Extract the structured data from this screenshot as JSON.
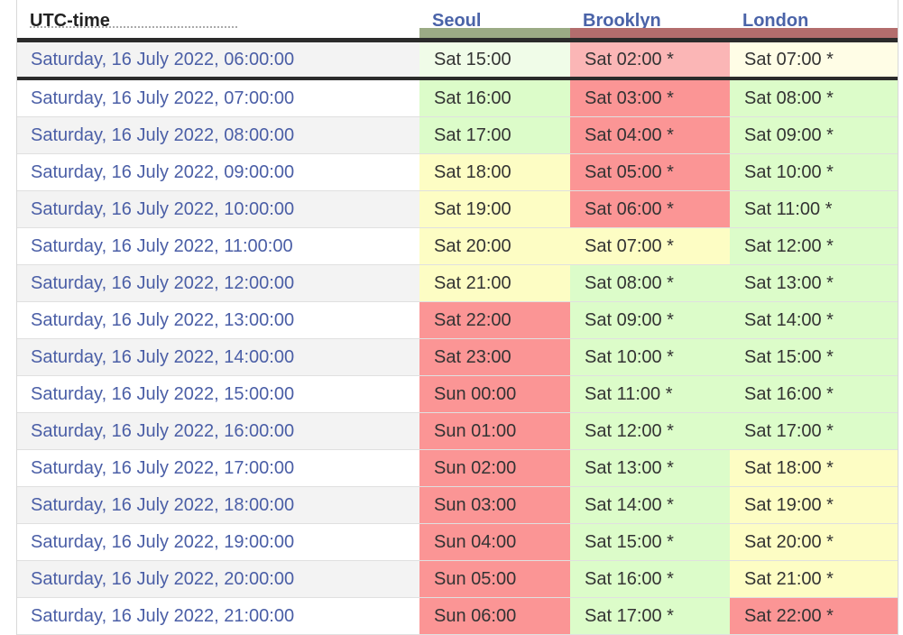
{
  "colors": {
    "green": "#dcfcc9",
    "yellow": "#fdfdc4",
    "red": "#fb9595",
    "pale_green": "#f0fce8",
    "pale_red": "#fbb6b6",
    "pale_yellow": "#fffde6",
    "header_green": "#9bab85",
    "header_red": "#b36d6d"
  },
  "header": {
    "utc_label": "UTC-time",
    "cities": [
      {
        "name": "Seoul",
        "strip": "header_green"
      },
      {
        "name": "Brooklyn",
        "strip": "header_red"
      },
      {
        "name": "London",
        "strip": "header_red"
      }
    ]
  },
  "rows": [
    {
      "utc": "Saturday, 16 July 2022, 06:00:00",
      "current": true,
      "cells": [
        {
          "t": "Sat 15:00",
          "c": "pale_green"
        },
        {
          "t": "Sat 02:00 *",
          "c": "pale_red"
        },
        {
          "t": "Sat 07:00 *",
          "c": "pale_yellow"
        }
      ]
    },
    {
      "utc": "Saturday, 16 July 2022, 07:00:00",
      "cells": [
        {
          "t": "Sat 16:00",
          "c": "green"
        },
        {
          "t": "Sat 03:00 *",
          "c": "red"
        },
        {
          "t": "Sat 08:00 *",
          "c": "green"
        }
      ]
    },
    {
      "utc": "Saturday, 16 July 2022, 08:00:00",
      "cells": [
        {
          "t": "Sat 17:00",
          "c": "green"
        },
        {
          "t": "Sat 04:00 *",
          "c": "red"
        },
        {
          "t": "Sat 09:00 *",
          "c": "green"
        }
      ]
    },
    {
      "utc": "Saturday, 16 July 2022, 09:00:00",
      "cells": [
        {
          "t": "Sat 18:00",
          "c": "yellow"
        },
        {
          "t": "Sat 05:00 *",
          "c": "red"
        },
        {
          "t": "Sat 10:00 *",
          "c": "green"
        }
      ]
    },
    {
      "utc": "Saturday, 16 July 2022, 10:00:00",
      "cells": [
        {
          "t": "Sat 19:00",
          "c": "yellow"
        },
        {
          "t": "Sat 06:00 *",
          "c": "red"
        },
        {
          "t": "Sat 11:00 *",
          "c": "green"
        }
      ]
    },
    {
      "utc": "Saturday, 16 July 2022, 11:00:00",
      "cells": [
        {
          "t": "Sat 20:00",
          "c": "yellow"
        },
        {
          "t": "Sat 07:00 *",
          "c": "yellow"
        },
        {
          "t": "Sat 12:00 *",
          "c": "green"
        }
      ]
    },
    {
      "utc": "Saturday, 16 July 2022, 12:00:00",
      "cells": [
        {
          "t": "Sat 21:00",
          "c": "yellow"
        },
        {
          "t": "Sat 08:00 *",
          "c": "green"
        },
        {
          "t": "Sat 13:00 *",
          "c": "green"
        }
      ]
    },
    {
      "utc": "Saturday, 16 July 2022, 13:00:00",
      "cells": [
        {
          "t": "Sat 22:00",
          "c": "red"
        },
        {
          "t": "Sat 09:00 *",
          "c": "green"
        },
        {
          "t": "Sat 14:00 *",
          "c": "green"
        }
      ]
    },
    {
      "utc": "Saturday, 16 July 2022, 14:00:00",
      "cells": [
        {
          "t": "Sat 23:00",
          "c": "red"
        },
        {
          "t": "Sat 10:00 *",
          "c": "green"
        },
        {
          "t": "Sat 15:00 *",
          "c": "green"
        }
      ]
    },
    {
      "utc": "Saturday, 16 July 2022, 15:00:00",
      "cells": [
        {
          "t": "Sun 00:00",
          "c": "red"
        },
        {
          "t": "Sat 11:00 *",
          "c": "green"
        },
        {
          "t": "Sat 16:00 *",
          "c": "green"
        }
      ]
    },
    {
      "utc": "Saturday, 16 July 2022, 16:00:00",
      "cells": [
        {
          "t": "Sun 01:00",
          "c": "red"
        },
        {
          "t": "Sat 12:00 *",
          "c": "green"
        },
        {
          "t": "Sat 17:00 *",
          "c": "green"
        }
      ]
    },
    {
      "utc": "Saturday, 16 July 2022, 17:00:00",
      "cells": [
        {
          "t": "Sun 02:00",
          "c": "red"
        },
        {
          "t": "Sat 13:00 *",
          "c": "green"
        },
        {
          "t": "Sat 18:00 *",
          "c": "yellow"
        }
      ]
    },
    {
      "utc": "Saturday, 16 July 2022, 18:00:00",
      "cells": [
        {
          "t": "Sun 03:00",
          "c": "red"
        },
        {
          "t": "Sat 14:00 *",
          "c": "green"
        },
        {
          "t": "Sat 19:00 *",
          "c": "yellow"
        }
      ]
    },
    {
      "utc": "Saturday, 16 July 2022, 19:00:00",
      "cells": [
        {
          "t": "Sun 04:00",
          "c": "red"
        },
        {
          "t": "Sat 15:00 *",
          "c": "green"
        },
        {
          "t": "Sat 20:00 *",
          "c": "yellow"
        }
      ]
    },
    {
      "utc": "Saturday, 16 July 2022, 20:00:00",
      "cells": [
        {
          "t": "Sun 05:00",
          "c": "red"
        },
        {
          "t": "Sat 16:00 *",
          "c": "green"
        },
        {
          "t": "Sat 21:00 *",
          "c": "yellow"
        }
      ]
    },
    {
      "utc": "Saturday, 16 July 2022, 21:00:00",
      "cells": [
        {
          "t": "Sun 06:00",
          "c": "red"
        },
        {
          "t": "Sat 17:00 *",
          "c": "green"
        },
        {
          "t": "Sat 22:00 *",
          "c": "red"
        }
      ]
    }
  ]
}
